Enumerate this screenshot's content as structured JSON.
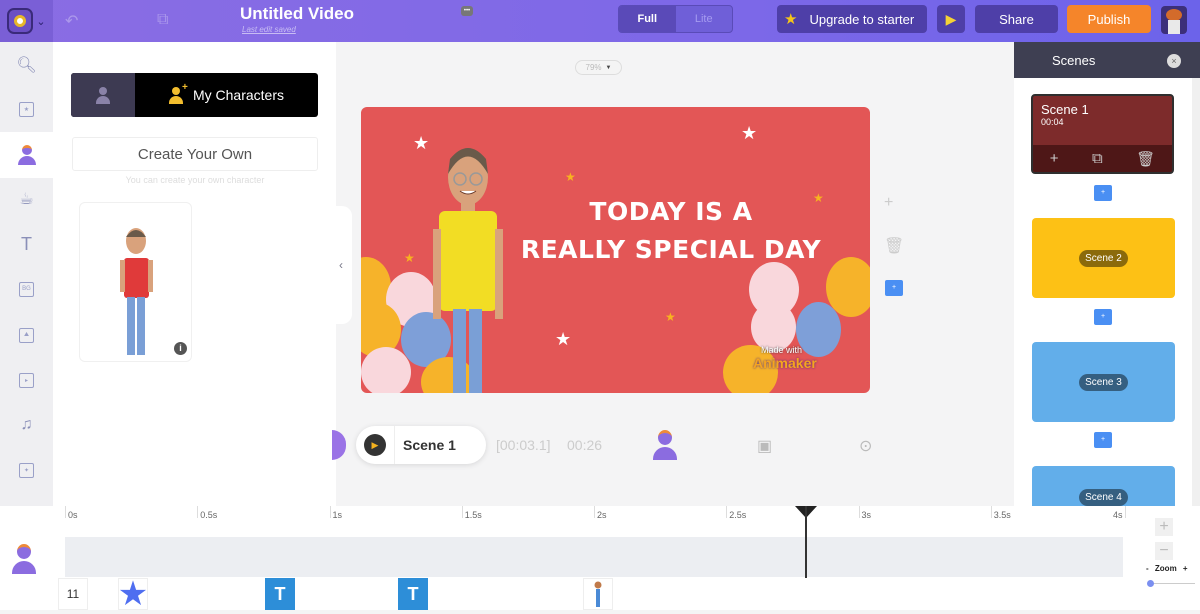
{
  "header": {
    "title": "Untitled Video",
    "save_status": "Last edit saved",
    "mode_toggle": {
      "options": [
        "Full",
        "Lite"
      ],
      "selected": "Full"
    },
    "upgrade_label": "Upgrade to starter",
    "share_label": "Share",
    "publish_label": "Publish",
    "colors": {
      "publish": "#f5852a",
      "bar": "#7d68e8"
    }
  },
  "left_rail": {
    "items": [
      {
        "icon": "search-icon",
        "glyph": "⚲"
      },
      {
        "icon": "scene-template-icon",
        "glyph": "▦"
      },
      {
        "icon": "character-icon",
        "active": true
      },
      {
        "icon": "props-cup-icon",
        "glyph": "☕"
      },
      {
        "icon": "text-icon",
        "glyph": "T"
      },
      {
        "icon": "background-icon",
        "glyph": "BG"
      },
      {
        "icon": "image-icon",
        "glyph": "⛰"
      },
      {
        "icon": "video-icon",
        "glyph": "▣"
      },
      {
        "icon": "music-icon",
        "glyph": "♫"
      },
      {
        "icon": "effects-icon",
        "glyph": "✦"
      }
    ]
  },
  "character_panel": {
    "tab_my_characters": "My Characters",
    "create_button": "Create Your Own",
    "create_hint": "You can create your own character",
    "info_glyph": "i"
  },
  "canvas": {
    "zoom_level": "79%",
    "headline_line1": "TODAY IS A",
    "headline_line2": "REALLY SPECIAL DAY",
    "watermark_top": "Made with",
    "watermark_brand": "Animaker",
    "stage_color": "#e35656",
    "collapse_glyph": "‹",
    "add_glyph": "+",
    "delete_glyph": "🗑",
    "add_scene_glyph": "+"
  },
  "scene_bar": {
    "scene_name": "Scene 1",
    "current_time": "[00:03.1]",
    "total_time": "00:26"
  },
  "scenes_panel": {
    "title": "Scenes",
    "close_glyph": "×",
    "scenes": [
      {
        "name": "Scene 1",
        "duration": "00:04",
        "color": "#7d2b2b",
        "selected": true
      },
      {
        "name": "Scene 2",
        "color": "#fdc115"
      },
      {
        "name": "Scene 3",
        "color": "#62aeea"
      },
      {
        "name": "Scene 4",
        "color": "#62aeea"
      }
    ],
    "scene_tools": {
      "add": "+",
      "duplicate": "⧉",
      "delete": "🗑"
    },
    "insert_glyph": "+"
  },
  "timeline": {
    "ticks": [
      "0s",
      "0.5s",
      "1s",
      "1.5s",
      "2s",
      "2.5s",
      "3s",
      "3.5s",
      "4s"
    ],
    "playhead_time_s": 3.1,
    "thumbs": [
      {
        "type": "number",
        "label": "11"
      },
      {
        "type": "star"
      },
      {
        "type": "text",
        "label": "T"
      },
      {
        "type": "text",
        "label": "T"
      },
      {
        "type": "character"
      }
    ],
    "zoom": {
      "label": "Zoom",
      "minus": "-",
      "plus": "+",
      "value": 0
    }
  }
}
